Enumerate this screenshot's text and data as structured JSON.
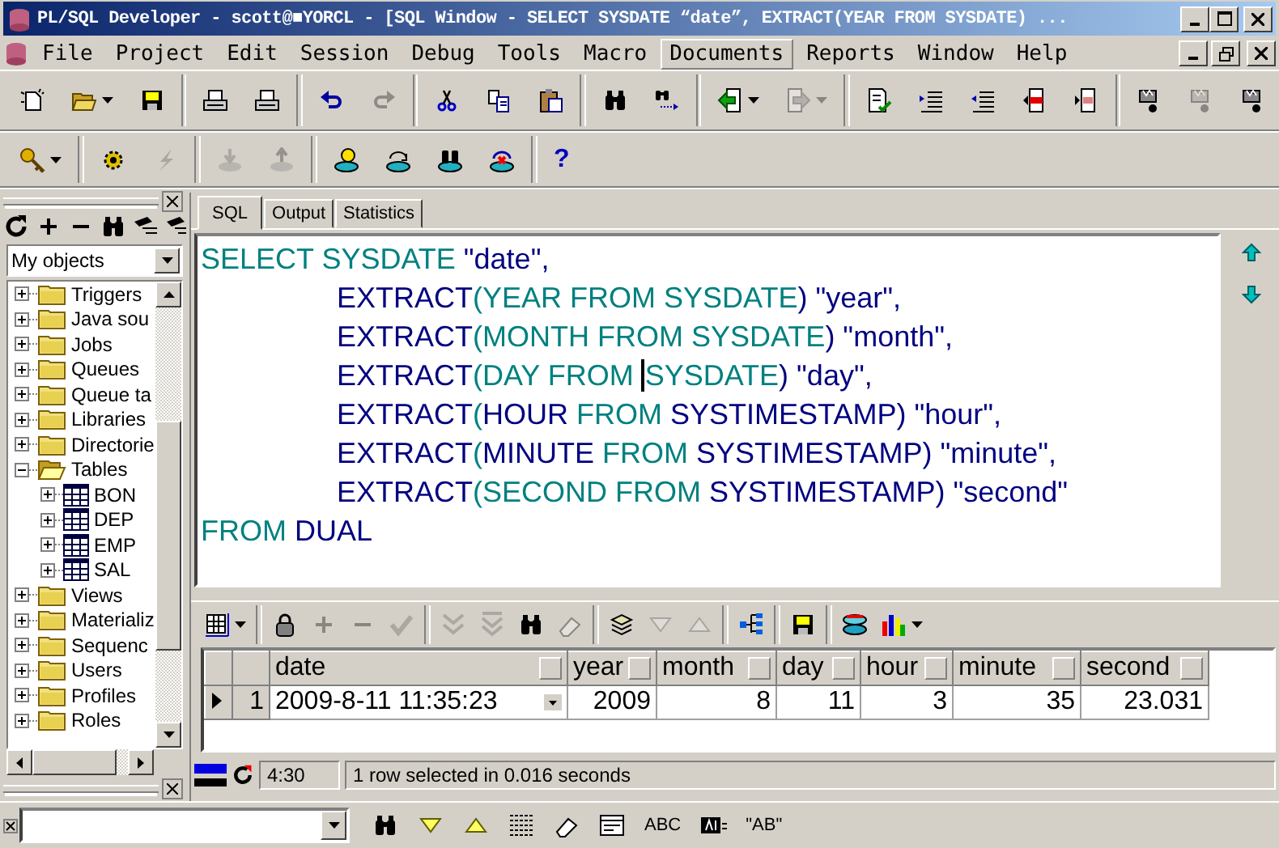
{
  "window": {
    "title": "PL/SQL Developer - scott@■YORCL - [SQL Window - SELECT SYSDATE “date”, EXTRACT(YEAR FROM SYSDATE) ..."
  },
  "menu": [
    {
      "label": "File",
      "selected": false
    },
    {
      "label": "Project",
      "selected": false
    },
    {
      "label": "Edit",
      "selected": false
    },
    {
      "label": "Session",
      "selected": false
    },
    {
      "label": "Debug",
      "selected": false
    },
    {
      "label": "Tools",
      "selected": false
    },
    {
      "label": "Macro",
      "selected": false
    },
    {
      "label": "Documents",
      "selected": true
    },
    {
      "label": "Reports",
      "selected": false
    },
    {
      "label": "Window",
      "selected": false
    },
    {
      "label": "Help",
      "selected": false
    }
  ],
  "toolbar_1": [
    {
      "kind": "new",
      "disabled": false
    },
    {
      "kind": "open",
      "disabled": false,
      "dropdown": true
    },
    {
      "kind": "save",
      "disabled": false
    },
    {
      "kind": "sep"
    },
    {
      "kind": "print",
      "disabled": false
    },
    {
      "kind": "print",
      "disabled": false
    },
    {
      "kind": "sep"
    },
    {
      "kind": "undo",
      "disabled": false
    },
    {
      "kind": "redo",
      "disabled": true
    },
    {
      "kind": "sep"
    },
    {
      "kind": "cut",
      "disabled": false
    },
    {
      "kind": "copy",
      "disabled": false
    },
    {
      "kind": "paste",
      "disabled": false
    },
    {
      "kind": "sep"
    },
    {
      "kind": "find",
      "disabled": false
    },
    {
      "kind": "findnext",
      "disabled": false
    },
    {
      "kind": "sep"
    },
    {
      "kind": "back",
      "disabled": false,
      "dropdown": true
    },
    {
      "kind": "forward",
      "disabled": true,
      "dropdown": true
    },
    {
      "kind": "sep"
    },
    {
      "kind": "doccheck",
      "disabled": false
    },
    {
      "kind": "indent",
      "disabled": false
    },
    {
      "kind": "outdent",
      "disabled": false
    },
    {
      "kind": "export",
      "disabled": false
    },
    {
      "kind": "import",
      "disabled": false
    },
    {
      "kind": "sep"
    },
    {
      "kind": "debug",
      "disabled": false
    },
    {
      "kind": "debug",
      "disabled": true
    },
    {
      "kind": "debug",
      "disabled": false
    }
  ],
  "toolbar_2": [
    {
      "kind": "key",
      "disabled": false,
      "dropdown": true
    },
    {
      "kind": "sep"
    },
    {
      "kind": "gear",
      "disabled": false
    },
    {
      "kind": "bolt",
      "disabled": true
    },
    {
      "kind": "sep"
    },
    {
      "kind": "dbdown",
      "disabled": true
    },
    {
      "kind": "dbup",
      "disabled": true
    },
    {
      "kind": "sep"
    },
    {
      "kind": "dbbulb",
      "disabled": false
    },
    {
      "kind": "dbsql",
      "disabled": false
    },
    {
      "kind": "dbfind",
      "disabled": false
    },
    {
      "kind": "dbx",
      "disabled": false
    },
    {
      "kind": "sep"
    },
    {
      "kind": "help",
      "disabled": false,
      "label": "?"
    }
  ],
  "object_browser": {
    "tools": [
      {
        "kind": "refresh",
        "disabled": false
      },
      {
        "kind": "plus",
        "disabled": false
      },
      {
        "kind": "minus",
        "disabled": false
      },
      {
        "kind": "find",
        "disabled": false
      },
      {
        "kind": "filter",
        "disabled": false
      },
      {
        "kind": "filter",
        "disabled": false
      }
    ],
    "filter": "My objects",
    "tree": [
      {
        "label": "Triggers",
        "kind": "folder",
        "expanded": false
      },
      {
        "label": "Java sou",
        "kind": "folder",
        "expanded": false
      },
      {
        "label": "Jobs",
        "kind": "folder",
        "expanded": false
      },
      {
        "label": "Queues",
        "kind": "folder",
        "expanded": false
      },
      {
        "label": "Queue ta",
        "kind": "folder",
        "expanded": false
      },
      {
        "label": "Libraries",
        "kind": "folder",
        "expanded": false
      },
      {
        "label": "Directorie",
        "kind": "folder",
        "expanded": false
      },
      {
        "label": "Tables",
        "kind": "folder",
        "expanded": true,
        "children": [
          {
            "label": "BON",
            "kind": "table",
            "expanded": false
          },
          {
            "label": "DEP",
            "kind": "table",
            "expanded": false
          },
          {
            "label": "EMP",
            "kind": "table",
            "expanded": false
          },
          {
            "label": "SAL",
            "kind": "table",
            "expanded": false
          }
        ]
      },
      {
        "label": "Views",
        "kind": "folder",
        "expanded": false
      },
      {
        "label": "Materializ",
        "kind": "folder",
        "expanded": false
      },
      {
        "label": "Sequenc",
        "kind": "folder",
        "expanded": false
      },
      {
        "label": "Users",
        "kind": "folder",
        "expanded": false
      },
      {
        "label": "Profiles",
        "kind": "folder",
        "expanded": false
      },
      {
        "label": "Roles",
        "kind": "folder",
        "expanded": false
      }
    ]
  },
  "tabs": [
    {
      "label": "SQL",
      "selected": true
    },
    {
      "label": "Output",
      "selected": false
    },
    {
      "label": "Statistics",
      "selected": false
    }
  ],
  "editor": {
    "lines": [
      {
        "indent": false,
        "tokens": [
          {
            "text": "SELECT SYSDATE",
            "kind": "keyword"
          },
          {
            "text": " \"date\",",
            "kind": "plain"
          }
        ]
      },
      {
        "indent": true,
        "tokens": [
          {
            "text": "EXTRACT",
            "kind": "plain"
          },
          {
            "text": "(YEAR FROM SYSDATE",
            "kind": "keyword"
          },
          {
            "text": ") \"year\",",
            "kind": "plain"
          }
        ]
      },
      {
        "indent": true,
        "tokens": [
          {
            "text": "EXTRACT",
            "kind": "plain"
          },
          {
            "text": "(MONTH FROM SYSDATE",
            "kind": "keyword"
          },
          {
            "text": ") \"month\",",
            "kind": "plain"
          }
        ]
      },
      {
        "indent": true,
        "tokens": [
          {
            "text": "EXTRACT",
            "kind": "plain"
          },
          {
            "text": "(DAY FROM ",
            "kind": "keyword"
          },
          {
            "text": "SYSDATE",
            "kind": "keyword",
            "cursor": true
          },
          {
            "text": ") \"day\",",
            "kind": "plain"
          }
        ]
      },
      {
        "indent": true,
        "tokens": [
          {
            "text": "EXTRACT",
            "kind": "plain"
          },
          {
            "text": "(",
            "kind": "keyword"
          },
          {
            "text": "HOUR ",
            "kind": "plain"
          },
          {
            "text": "FROM",
            "kind": "keyword"
          },
          {
            "text": " SYSTIMESTAMP) \"hour\",",
            "kind": "plain"
          }
        ]
      },
      {
        "indent": true,
        "tokens": [
          {
            "text": "EXTRACT",
            "kind": "plain"
          },
          {
            "text": "(",
            "kind": "keyword"
          },
          {
            "text": "MINUTE ",
            "kind": "plain"
          },
          {
            "text": "FROM",
            "kind": "keyword"
          },
          {
            "text": " SYSTIMESTAMP) \"minute\",",
            "kind": "plain"
          }
        ]
      },
      {
        "indent": true,
        "tokens": [
          {
            "text": "EXTRACT",
            "kind": "plain"
          },
          {
            "text": "(SECOND FROM",
            "kind": "keyword"
          },
          {
            "text": " SYSTIMESTAMP) \"second\"",
            "kind": "plain"
          }
        ]
      },
      {
        "indent": false,
        "tokens": [
          {
            "text": "FROM",
            "kind": "keyword"
          },
          {
            "text": " DUAL",
            "kind": "plain"
          }
        ]
      }
    ]
  },
  "results_toolbar": [
    {
      "kind": "grid",
      "disabled": false,
      "dropdown": true
    },
    {
      "kind": "sep"
    },
    {
      "kind": "lock",
      "disabled": false
    },
    {
      "kind": "plus",
      "disabled": true
    },
    {
      "kind": "minus",
      "disabled": true
    },
    {
      "kind": "check",
      "disabled": true
    },
    {
      "kind": "sep"
    },
    {
      "kind": "nextpage",
      "disabled": true
    },
    {
      "kind": "lastpage",
      "disabled": true
    },
    {
      "kind": "find",
      "disabled": false
    },
    {
      "kind": "eraser",
      "disabled": true
    },
    {
      "kind": "sep"
    },
    {
      "kind": "exportdb",
      "disabled": false
    },
    {
      "kind": "tridown",
      "disabled": true
    },
    {
      "kind": "triup",
      "disabled": true
    },
    {
      "kind": "sep"
    },
    {
      "kind": "tree",
      "disabled": false
    },
    {
      "kind": "sep"
    },
    {
      "kind": "save",
      "disabled": false
    },
    {
      "kind": "sep"
    },
    {
      "kind": "db",
      "disabled": false
    },
    {
      "kind": "chart",
      "disabled": false,
      "dropdown": true
    }
  ],
  "results": {
    "columns": [
      "date",
      "year",
      "month",
      "day",
      "hour",
      "minute",
      "second"
    ],
    "rows": [
      {
        "number": "1",
        "current": true,
        "cells": [
          "2009-8-11 11:35:23",
          "2009",
          "8",
          "11",
          "3",
          "35",
          "23.031"
        ]
      }
    ]
  },
  "status_bar": {
    "position": "4:30",
    "message": "1 row selected in 0.016 seconds"
  },
  "find_bar": [
    {
      "kind": "find",
      "disabled": false
    },
    {
      "kind": "tridown",
      "disabled": false
    },
    {
      "kind": "triup",
      "disabled": false
    },
    {
      "kind": "lines",
      "disabled": false
    },
    {
      "kind": "eraser",
      "disabled": false
    },
    {
      "kind": "form",
      "disabled": false
    },
    {
      "kind": "text",
      "disabled": false,
      "label": "ABC"
    },
    {
      "kind": "wordbox",
      "disabled": false
    },
    {
      "kind": "text",
      "disabled": false,
      "label": "\"AB\""
    }
  ]
}
